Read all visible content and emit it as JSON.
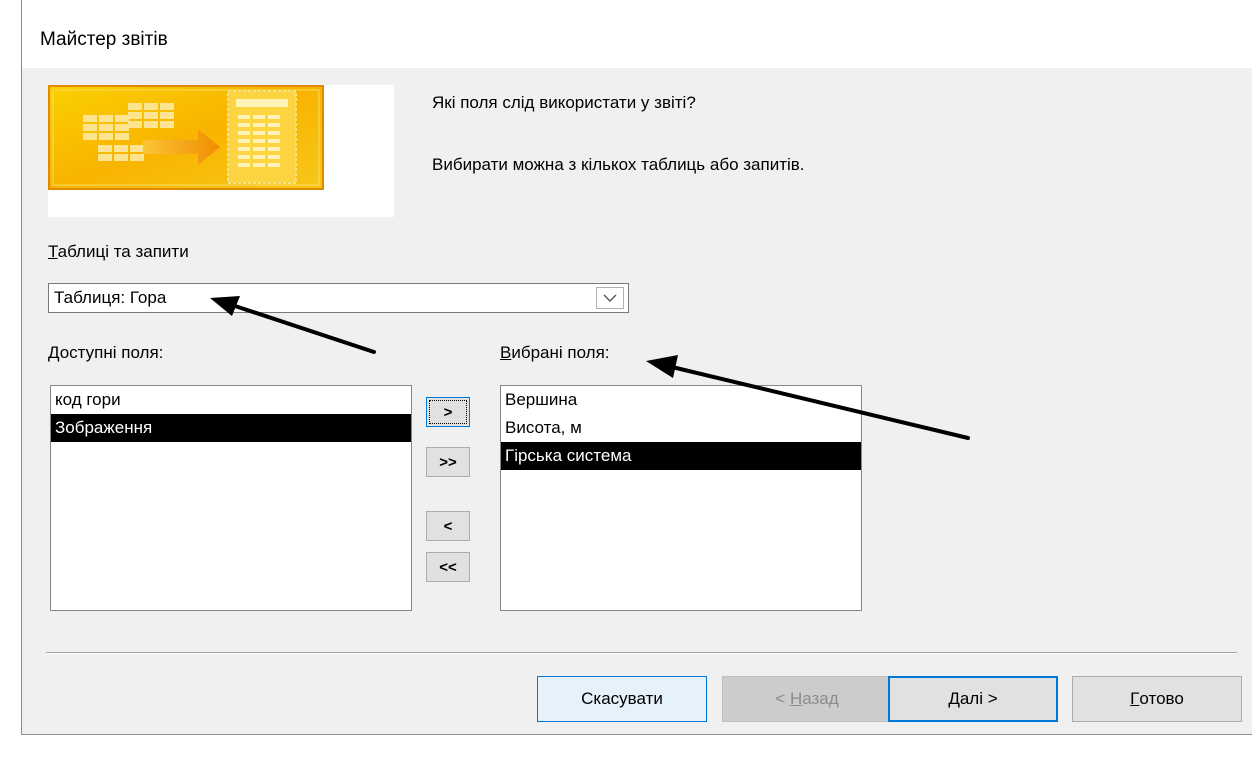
{
  "window": {
    "title": "Майстер звітів"
  },
  "intro": {
    "question": "Які поля слід використати у звіті?",
    "hint": "Вибирати можна з кількох таблиць або запитів."
  },
  "tables_queries": {
    "label_accel": "Т",
    "label_rest": "аблиці та запити",
    "selected": "Таблиця: Гора"
  },
  "available_fields": {
    "label_accel": "Д",
    "label_rest": "оступні поля:",
    "items": [
      "код гори",
      "Зображення"
    ],
    "selected_index": 1
  },
  "selected_fields": {
    "label_accel": "В",
    "label_rest": "ибрані поля:",
    "items": [
      "Вершина",
      "Висота, м",
      "Гірська система"
    ],
    "selected_index": 2
  },
  "move_buttons": {
    "add_one": ">",
    "add_all": ">>",
    "remove_one": "<",
    "remove_all": "<<"
  },
  "footer": {
    "cancel": "Скасувати",
    "back_prefix": "< ",
    "back_accel": "Н",
    "back_rest": "азад",
    "next_accel": "Д",
    "next_rest": "алі >",
    "finish_accel": "Г",
    "finish_rest": "отово"
  },
  "colors": {
    "accent": "#0078d7",
    "banner_orange": "#f6a800",
    "selection": "#000000"
  },
  "icons": {
    "banner": "report-wizard-banner-icon",
    "dropdown": "chevron-down-icon",
    "annotation_arrows": "annotation-arrow-icon"
  }
}
